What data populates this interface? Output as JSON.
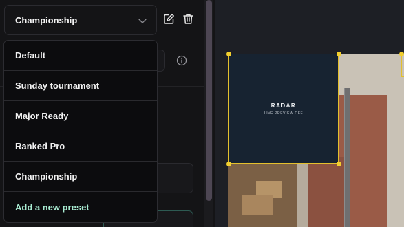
{
  "preset_select": {
    "selected": "Championship",
    "chevron_icon": "chevron-down-icon"
  },
  "toolbar": {
    "edit_icon": "edit-icon",
    "delete_icon": "trash-icon"
  },
  "info_icon": "info-icon",
  "preset_menu": {
    "items": [
      {
        "label": "Default"
      },
      {
        "label": "Sunday tournament"
      },
      {
        "label": "Major Ready"
      },
      {
        "label": "Ranked Pro"
      },
      {
        "label": "Championship"
      }
    ],
    "add_label": "Add a new preset"
  },
  "preview": {
    "widget_title": "RADAR",
    "widget_subtitle": "LIVE PREVIEW OFF"
  },
  "colors": {
    "accent_selection": "#e4c02d",
    "add_preset_text": "#a9ecd2",
    "menu_bg": "#0c0c0e",
    "radar_bg": "#172331"
  }
}
